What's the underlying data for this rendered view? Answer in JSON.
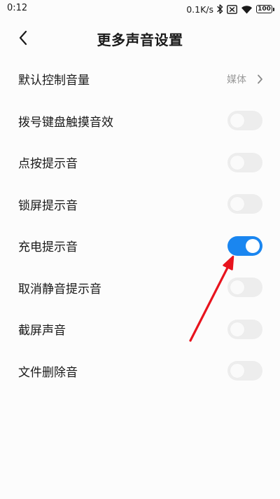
{
  "status_bar": {
    "time": "0:12",
    "network_speed": "0.1K/s",
    "battery_level": "100",
    "icons": [
      "bluetooth-icon",
      "sim-error-icon",
      "wifi-icon",
      "battery-icon"
    ]
  },
  "header": {
    "back_icon": "chevron-left-icon",
    "title": "更多声音设置"
  },
  "settings": {
    "default_volume": {
      "label": "默认控制音量",
      "value": "媒体"
    },
    "items": [
      {
        "label": "拨号键盘触摸音效",
        "enabled": false
      },
      {
        "label": "点按提示音",
        "enabled": false
      },
      {
        "label": "锁屏提示音",
        "enabled": false
      },
      {
        "label": "充电提示音",
        "enabled": true
      },
      {
        "label": "取消静音提示音",
        "enabled": false
      },
      {
        "label": "截屏声音",
        "enabled": false
      },
      {
        "label": "文件删除音",
        "enabled": false
      }
    ]
  },
  "colors": {
    "toggle_on": "#1a86f0",
    "toggle_off": "#ededed",
    "annotation_arrow": "#e8141e"
  }
}
